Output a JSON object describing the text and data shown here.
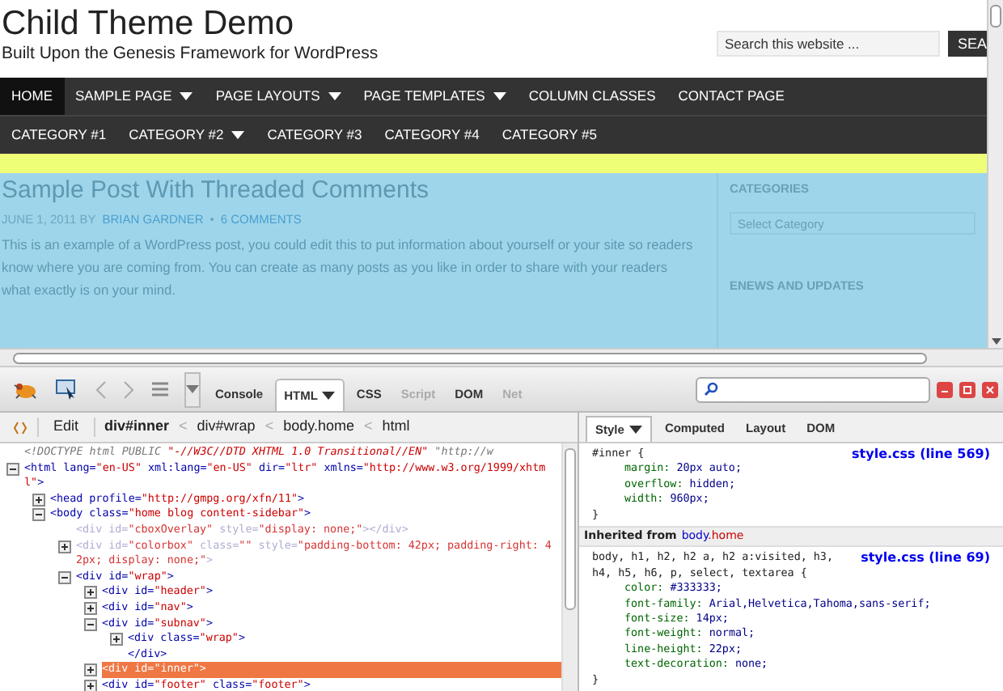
{
  "site": {
    "title": "Child Theme Demo",
    "tagline": "Built Upon the Genesis Framework for WordPress",
    "search": {
      "placeholder": "Search this website ...",
      "button": "SEA"
    }
  },
  "nav": [
    {
      "label": "HOME",
      "selected": true,
      "dropdown": false
    },
    {
      "label": "SAMPLE PAGE",
      "selected": false,
      "dropdown": true
    },
    {
      "label": "PAGE LAYOUTS",
      "selected": false,
      "dropdown": true
    },
    {
      "label": "PAGE TEMPLATES",
      "selected": false,
      "dropdown": true
    },
    {
      "label": "COLUMN CLASSES",
      "selected": false,
      "dropdown": false
    },
    {
      "label": "CONTACT PAGE",
      "selected": false,
      "dropdown": false
    }
  ],
  "subnav": [
    {
      "label": "CATEGORY #1",
      "dropdown": false
    },
    {
      "label": "CATEGORY #2",
      "dropdown": true
    },
    {
      "label": "CATEGORY #3",
      "dropdown": false
    },
    {
      "label": "CATEGORY #4",
      "dropdown": false
    },
    {
      "label": "CATEGORY #5",
      "dropdown": false
    }
  ],
  "post": {
    "title": "Sample Post With Threaded Comments",
    "date_by": "JUNE 1, 2011 BY",
    "author": "BRIAN GARDNER",
    "separator": "•",
    "comments": "6 COMMENTS",
    "body": "This is an example of a WordPress post, you could edit this to put information about yourself or your site so readers know where you are coming from. You can create as many posts as you like in order to share with your readers what exactly is on your mind."
  },
  "sidebar": {
    "categories_heading": "CATEGORIES",
    "select_placeholder": "Select Category",
    "enews_heading": "ENEWS AND UPDATES"
  },
  "firebug": {
    "tabs": [
      {
        "label": "Console",
        "selected": false,
        "disabled": false,
        "dropdown": false
      },
      {
        "label": "HTML",
        "selected": true,
        "disabled": false,
        "dropdown": true
      },
      {
        "label": "CSS",
        "selected": false,
        "disabled": false,
        "dropdown": false
      },
      {
        "label": "Script",
        "selected": false,
        "disabled": true,
        "dropdown": false
      },
      {
        "label": "DOM",
        "selected": false,
        "disabled": false,
        "dropdown": false
      },
      {
        "label": "Net",
        "selected": false,
        "disabled": true,
        "dropdown": false
      }
    ],
    "edit": "Edit",
    "breadcrumb": [
      {
        "label": "div#inner",
        "selected": true
      },
      {
        "label": "div#wrap",
        "selected": false
      },
      {
        "label": "body.home",
        "selected": false
      },
      {
        "label": "html",
        "selected": false
      }
    ],
    "breadcrumb_separator": "<",
    "tree": [
      {
        "text": "<!DOCTYPE html PUBLIC \"-//W3C//DTD XHTML 1.0 Transitional//EN\" \"http://w",
        "kind": "doctype"
      },
      {
        "text": "<html lang=\"en-US\" xml:lang=\"en-US\" dir=\"ltr\" xmlns=\"http://www.w3.org/1999/xhtml\">",
        "kind": "element",
        "expanded": true,
        "children": [
          {
            "text": "<head profile=\"http://gmpg.org/xfn/11\">",
            "kind": "element",
            "expanded": false
          },
          {
            "text": "<body class=\"home blog content-sidebar\">",
            "kind": "element",
            "expanded": true,
            "children": [
              {
                "text": "<div id=\"cboxOverlay\" style=\"display: none;\"></div>",
                "kind": "hidden"
              },
              {
                "text": "<div id=\"colorbox\" class=\"\" style=\"padding-bottom: 42px; padding-right: 42px; display: none;\">",
                "kind": "hidden",
                "expanded": false
              },
              {
                "text": "<div id=\"wrap\">",
                "kind": "element",
                "expanded": true,
                "children": [
                  {
                    "text": "<div id=\"header\">",
                    "kind": "element",
                    "expanded": false
                  },
                  {
                    "text": "<div id=\"nav\">",
                    "kind": "element",
                    "expanded": false
                  },
                  {
                    "text": "<div id=\"subnav\">",
                    "kind": "element",
                    "expanded": true,
                    "children": [
                      {
                        "text": "<div class=\"wrap\">",
                        "kind": "element",
                        "expanded": false
                      }
                    ],
                    "closing": "</div>"
                  },
                  {
                    "text": "<div id=\"inner\">",
                    "kind": "element",
                    "expanded": false,
                    "selected": true
                  },
                  {
                    "text": "<div id=\"footer\" class=\"footer\">",
                    "kind": "element",
                    "expanded": false
                  }
                ]
              }
            ]
          }
        ]
      }
    ],
    "side_tabs": [
      {
        "label": "Style",
        "selected": true,
        "dropdown": true
      },
      {
        "label": "Computed",
        "selected": false,
        "dropdown": false
      },
      {
        "label": "Layout",
        "selected": false,
        "dropdown": false
      },
      {
        "label": "DOM",
        "selected": false,
        "dropdown": false
      }
    ],
    "rules": [
      {
        "selector": "#inner {",
        "source": "style.css (line 569)",
        "declarations": [
          {
            "property": "margin:",
            "value": "20px auto;"
          },
          {
            "property": "overflow:",
            "value": "hidden;"
          },
          {
            "property": "width:",
            "value": "960px;"
          }
        ],
        "close": "}"
      }
    ],
    "inherited": {
      "label": "Inherited from",
      "element": "body",
      "class": ".home"
    },
    "inherited_rules": [
      {
        "selector": "body, h1, h2, h2 a, h2 a:visited, h3, h4, h5, h6, p, select, textarea {",
        "source": "style.css (line 69)",
        "declarations": [
          {
            "property": "color:",
            "value": "#333333;"
          },
          {
            "property": "font-family:",
            "value": "Arial,Helvetica,Tahoma,sans-serif;"
          },
          {
            "property": "font-size:",
            "value": "14px;"
          },
          {
            "property": "font-weight:",
            "value": "normal;"
          },
          {
            "property": "line-height:",
            "value": "22px;"
          },
          {
            "property": "text-decoration:",
            "value": "none;"
          }
        ],
        "close": "}"
      }
    ]
  }
}
